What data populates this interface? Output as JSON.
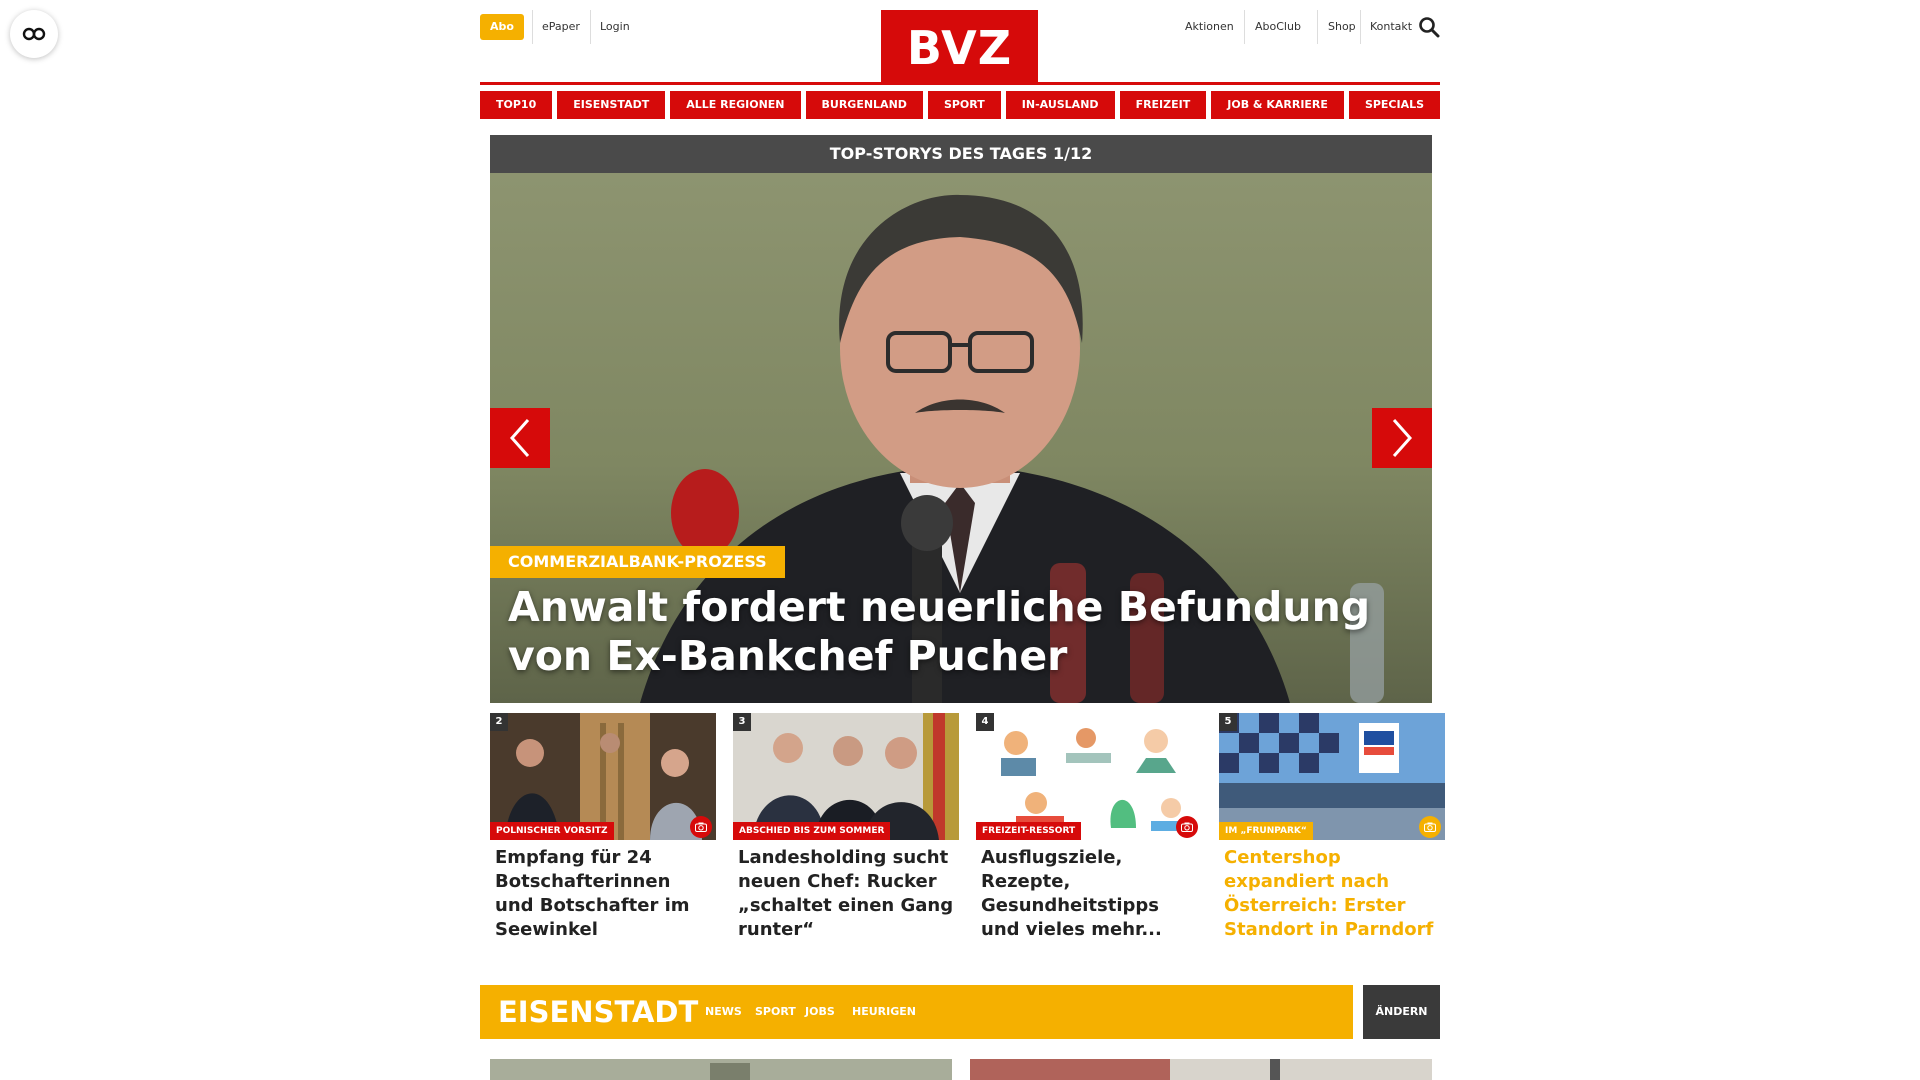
{
  "header": {
    "abo_label": "Abo",
    "left_links": [
      "ePaper",
      "Login"
    ],
    "logo_text": "BVZ",
    "right_links": [
      "Aktionen",
      "AboClub",
      "Shop",
      "Kontakt"
    ]
  },
  "nav": {
    "items": [
      "TOP10",
      "EISENSTADT",
      "ALLE REGIONEN",
      "BURGENLAND",
      "SPORT",
      "IN-AUSLAND",
      "FREIZEIT",
      "JOB & KARRIERE",
      "SPECIALS"
    ]
  },
  "top_stories": {
    "header": "TOP-STORYS DES TAGES 1/12",
    "hero": {
      "kicker": "COMMERZIALBANK-PROZESS",
      "title": "Anwalt fordert neuerliche Befundung von Ex-Bankchef Pucher"
    },
    "cards": [
      {
        "num": "2",
        "kicker": "POLNISCHER VORSITZ",
        "title": "Empfang für 24 Botschafterinnen und Botschafter im Seewinkel",
        "has_camera": true
      },
      {
        "num": "3",
        "kicker": "ABSCHIED BIS ZUM SOMMER",
        "title": "Landesholding sucht neuen Chef: Rucker „schaltet einen Gang runter“",
        "has_camera": false
      },
      {
        "num": "4",
        "kicker": "FREIZEIT-RESSORT",
        "title": "Ausflugsziele, Rezepte, Gesundheitstipps und vieles mehr...",
        "has_camera": true
      },
      {
        "num": "5",
        "kicker": "IM „FRUNPARK“",
        "title": "Centershop expandiert nach Österreich: Erster Standort in Parndorf",
        "has_camera": true,
        "accent": "yellow"
      }
    ]
  },
  "region": {
    "name": "EISENSTADT",
    "links": [
      "NEWS",
      "SPORT",
      "JOBS",
      "HEURIGEN"
    ],
    "change_label": "ÄNDERN"
  },
  "icons": {
    "accessibility": "accessibility-icon",
    "search": "search-icon",
    "prev": "chevron-left-icon",
    "next": "chevron-right-icon",
    "camera": "camera-icon"
  },
  "colors": {
    "brand_red": "#d60a0a",
    "accent_yellow": "#f5b000",
    "dark_gray": "#4a4a4a"
  }
}
